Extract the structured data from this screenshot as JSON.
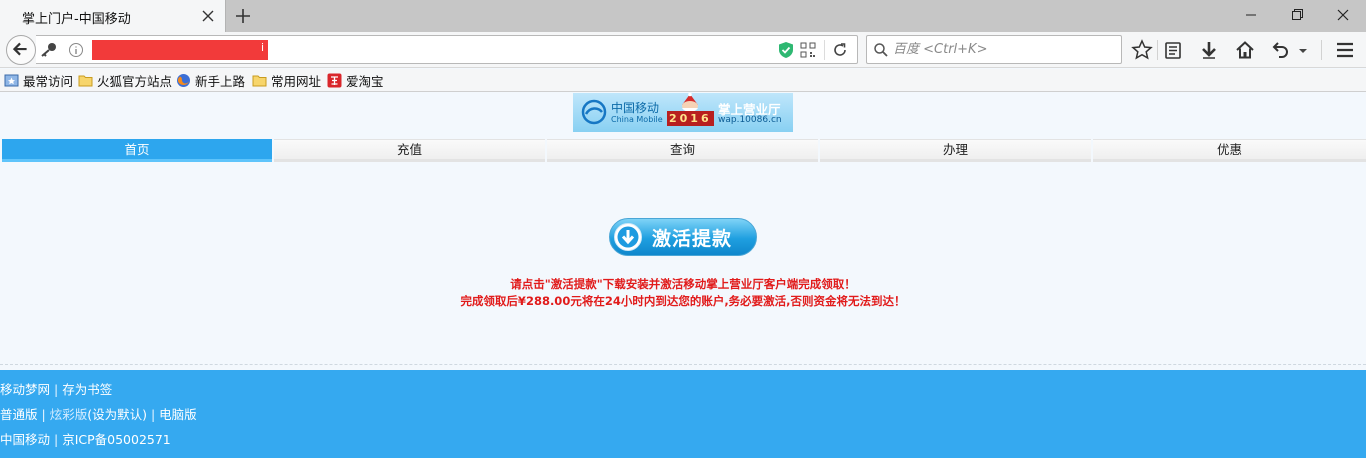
{
  "browser": {
    "tab_title": "掌上门户-中国移动",
    "search_placeholder": "百度 <Ctrl+K>",
    "url_tail": "i"
  },
  "bookmarks": [
    {
      "label": "最常访问",
      "icon": "star-folder-icon"
    },
    {
      "label": "火狐官方站点",
      "icon": "folder-icon"
    },
    {
      "label": "新手上路",
      "icon": "firefox-icon"
    },
    {
      "label": "常用网址",
      "icon": "folder-icon"
    },
    {
      "label": "爱淘宝",
      "icon": "taobao-icon"
    }
  ],
  "banner": {
    "brand_cn": "中国移动",
    "brand_en": "China Mobile",
    "hall": "掌上营业厅",
    "url": "wap.10086.cn",
    "year": "2016"
  },
  "menu": [
    {
      "label": "首页",
      "active": true
    },
    {
      "label": "充值",
      "active": false
    },
    {
      "label": "查询",
      "active": false
    },
    {
      "label": "办理",
      "active": false
    },
    {
      "label": "优惠",
      "active": false
    }
  ],
  "main": {
    "activate_label": "激活提款",
    "notice_1": "请点击\"激活提款\"下载安装并激活移动掌上营业厅客户端完成领取！",
    "notice_2": "完成领取后¥288.00元将在24小时内到达您的账户,务必要激活,否则资金将无法到达！"
  },
  "footer": {
    "row1": {
      "a": "移动梦网",
      "sep": " | ",
      "b": "存为书签"
    },
    "row2": {
      "a": "普通版",
      "sep1": " | ",
      "b": "炫彩版",
      "c": "(设为默认)",
      "sep2": " | ",
      "d": "电脑版"
    },
    "row3": {
      "a": "中国移动",
      "sep": " | ",
      "b": "京ICP备05002571"
    }
  },
  "colors": {
    "accent": "#35a9f0",
    "menu_active": "#2da6ee",
    "notice": "#e11b1b",
    "url_redaction": "#f23a3a"
  }
}
